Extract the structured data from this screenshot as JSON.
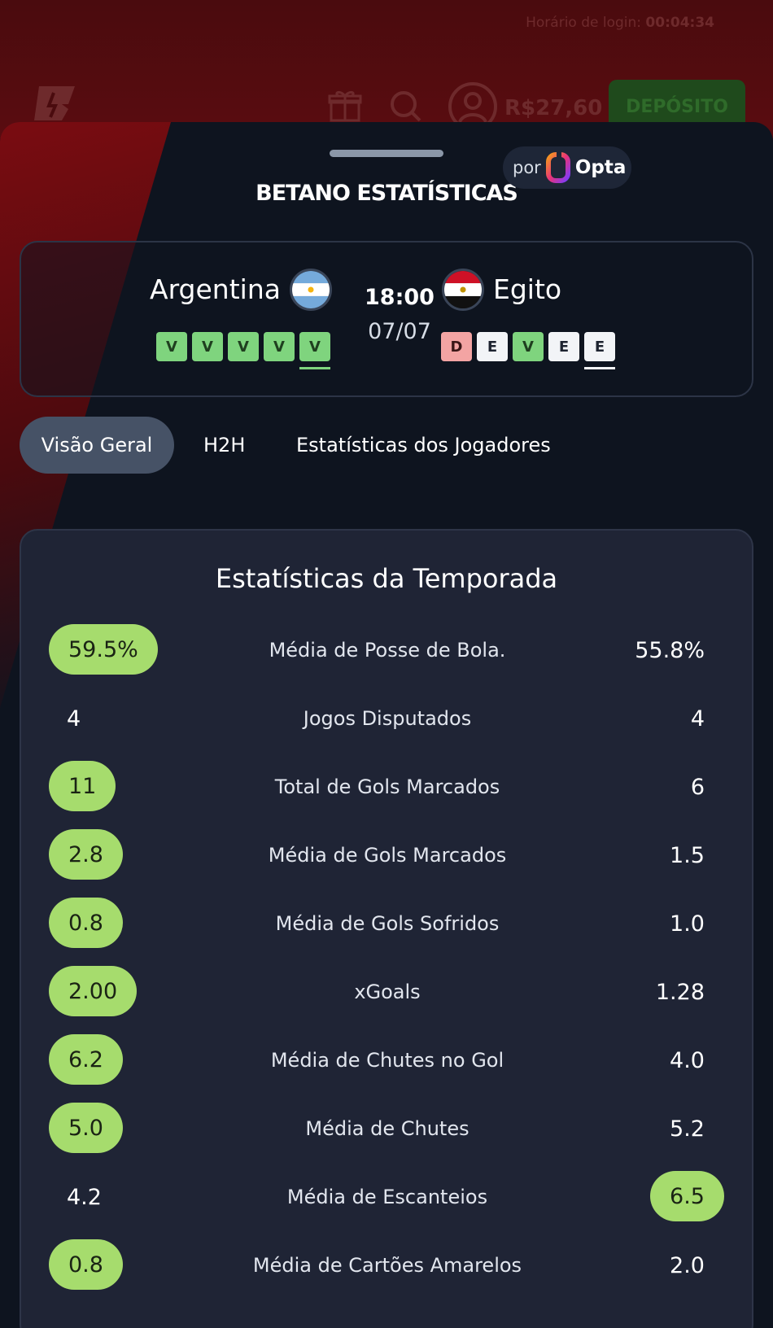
{
  "header": {
    "login_label": "Horário de login:",
    "login_time": "00:04:34",
    "balance": "R$27,60",
    "deposit_label": "DEPÓSITO"
  },
  "sheet": {
    "title": "BETANO ESTATÍSTICAS",
    "provider_prefix": "por",
    "provider_name": "Opta"
  },
  "match": {
    "home": {
      "name": "Argentina",
      "form": [
        "V",
        "V",
        "V",
        "V",
        "V"
      ]
    },
    "away": {
      "name": "Egito",
      "form": [
        "D",
        "E",
        "V",
        "E",
        "E"
      ]
    },
    "time": "18:00",
    "date": "07/07"
  },
  "tabs": [
    {
      "label": "Visão Geral",
      "active": true
    },
    {
      "label": "H2H",
      "active": false
    },
    {
      "label": "Estatísticas dos Jogadores",
      "active": false
    }
  ],
  "stats": {
    "title": "Estatísticas da Temporada",
    "rows": [
      {
        "label": "Média de Posse de Bola.",
        "home": "59.5%",
        "away": "55.8%",
        "leader": "home"
      },
      {
        "label": "Jogos Disputados",
        "home": "4",
        "away": "4",
        "leader": "none"
      },
      {
        "label": "Total de Gols Marcados",
        "home": "11",
        "away": "6",
        "leader": "home"
      },
      {
        "label": "Média de Gols Marcados",
        "home": "2.8",
        "away": "1.5",
        "leader": "home"
      },
      {
        "label": "Média de Gols Sofridos",
        "home": "0.8",
        "away": "1.0",
        "leader": "home"
      },
      {
        "label": "xGoals",
        "home": "2.00",
        "away": "1.28",
        "leader": "home"
      },
      {
        "label": "Média de Chutes no Gol",
        "home": "6.2",
        "away": "4.0",
        "leader": "home"
      },
      {
        "label": "Média de Chutes",
        "home": "5.0",
        "away": "5.2",
        "leader": "home"
      },
      {
        "label": "Média de Escanteios",
        "home": "4.2",
        "away": "6.5",
        "leader": "away"
      },
      {
        "label": "Média de Cartões Amarelos",
        "home": "0.8",
        "away": "2.0",
        "leader": "home"
      }
    ]
  },
  "colors": {
    "accent_green": "#a6dc6d",
    "form_win": "#7fd47e",
    "form_loss": "#f3a4a3",
    "form_draw": "#f2f4f7",
    "background": "#0e141f"
  }
}
